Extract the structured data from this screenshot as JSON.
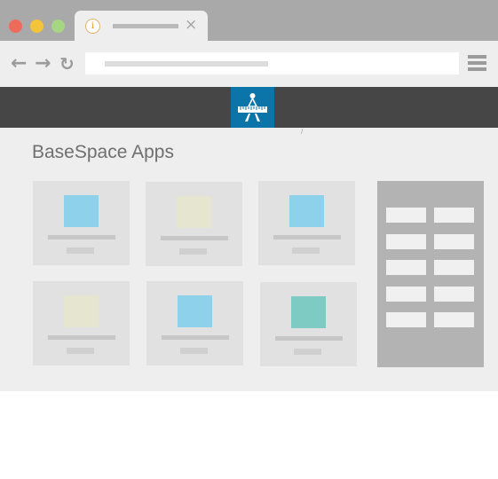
{
  "browser": {
    "tab": {
      "info_icon": "info-icon",
      "info_glyph": "i",
      "close_glyph": "×",
      "close_icon": "close-icon"
    },
    "toolbar": {
      "back_glyph": "←",
      "forward_glyph": "→",
      "reload_glyph": "↻",
      "icons": [
        "back-arrow-icon",
        "forward-arrow-icon",
        "reload-icon",
        "hamburger-menu-icon"
      ]
    },
    "traffic_lights": {
      "close": "#ee6b5a",
      "minimize": "#f3c33a",
      "maximize": "#a7d683"
    }
  },
  "app_header": {
    "logo_icon": "basespace-logo-icon",
    "stray_mark": "/"
  },
  "page": {
    "title": "BaseSpace Apps"
  },
  "apps": [
    {
      "thumb_color": "#8ed1ea"
    },
    {
      "thumb_color": "#e6e5cf"
    },
    {
      "thumb_color": "#8ed1ea"
    },
    {
      "thumb_color": "#e6e5cf"
    },
    {
      "thumb_color": "#8ed1ea"
    },
    {
      "thumb_color": "#7ecbc4"
    }
  ],
  "colors": {
    "titlebar": "#a9a9a9",
    "header": "#464646",
    "brand": "#0b74a8",
    "page_bg": "#eeeeee",
    "card_bg": "#e1e1e1",
    "side_panel": "#b3b3b3"
  }
}
